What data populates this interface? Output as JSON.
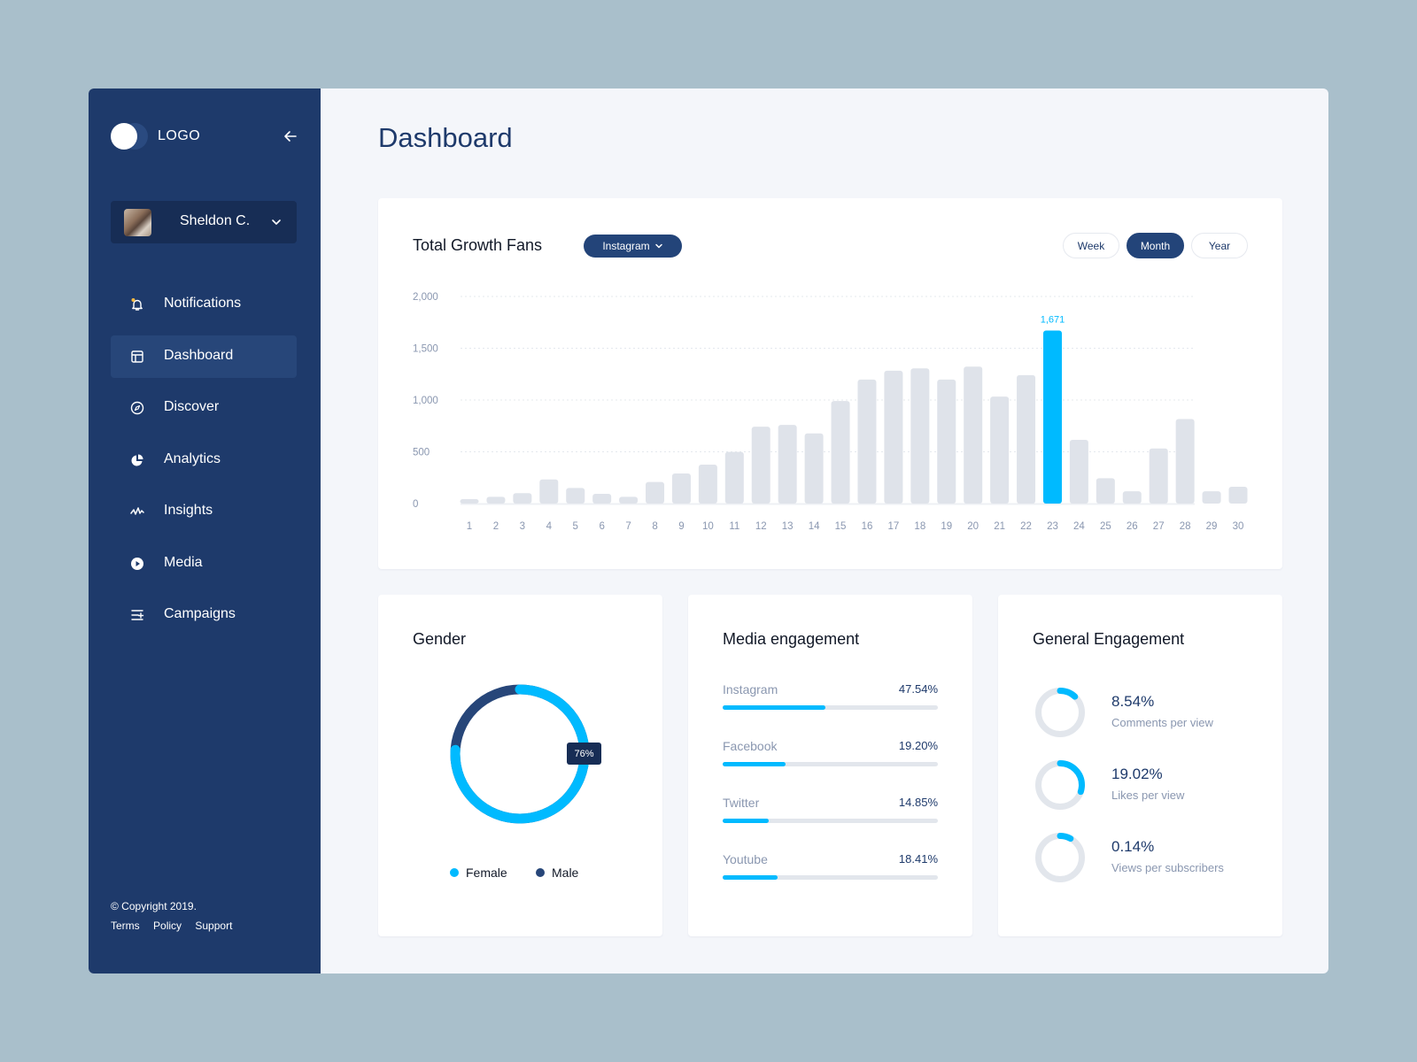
{
  "colors": {
    "accent": "#00BAFF",
    "primary": "#1E3A6B",
    "bar_default": "#DFE3EA",
    "track": "#E2E6EC",
    "male": "#274679"
  },
  "sidebar": {
    "logo_text": "LOGO",
    "collapse_icon": "arrow-left-icon",
    "user": {
      "name": "Sheldon C.",
      "chevron": "chevron-down-icon"
    },
    "items": [
      {
        "label": "Notifications",
        "icon": "bell-icon",
        "active": false
      },
      {
        "label": "Dashboard",
        "icon": "layout-icon",
        "active": true
      },
      {
        "label": "Discover",
        "icon": "compass-icon",
        "active": false
      },
      {
        "label": "Analytics",
        "icon": "pie-chart-icon",
        "active": false
      },
      {
        "label": "Insights",
        "icon": "activity-icon",
        "active": false
      },
      {
        "label": "Media",
        "icon": "play-icon",
        "active": false
      },
      {
        "label": "Campaigns",
        "icon": "list-plus-icon",
        "active": false
      }
    ],
    "footer": {
      "copyright": "© Copyright 2019.",
      "links": [
        "Terms",
        "Policy",
        "Support"
      ]
    }
  },
  "main": {
    "title": "Dashboard",
    "growth": {
      "title": "Total Growth Fans",
      "platform": "Instagram",
      "ranges": [
        {
          "label": "Week",
          "active": false
        },
        {
          "label": "Month",
          "active": true
        },
        {
          "label": "Year",
          "active": false
        }
      ]
    },
    "gender": {
      "title": "Gender",
      "tooltip": "76%",
      "female_share": 0.76,
      "legend": [
        {
          "label": "Female",
          "color": "#00BAFF"
        },
        {
          "label": "Male",
          "color": "#274679"
        }
      ]
    },
    "media_engagement": {
      "title": "Media engagement",
      "rows": [
        {
          "label": "Instagram",
          "value": "47.54%",
          "fraction": 0.4754
        },
        {
          "label": "Facebook",
          "value": "19.20%",
          "fraction": 0.292
        },
        {
          "label": "Twitter",
          "value": "14.85%",
          "fraction": 0.215
        },
        {
          "label": "Youtube",
          "value": "18.41%",
          "fraction": 0.255
        }
      ]
    },
    "general_engagement": {
      "title": "General Engagement",
      "rows": [
        {
          "value": "8.54%",
          "label": "Comments per view",
          "fraction": 0.12
        },
        {
          "value": "19.02%",
          "label": "Likes per view",
          "fraction": 0.3
        },
        {
          "value": "0.14%",
          "label": "Views per subscribers",
          "fraction": 0.08
        }
      ]
    }
  },
  "chart_data": {
    "type": "bar",
    "title": "Total Growth Fans",
    "xlabel": "",
    "ylabel": "",
    "ylim": [
      0,
      2000
    ],
    "yticks": [
      0,
      500,
      1000,
      1500,
      2000
    ],
    "ytick_labels": [
      "0",
      "500",
      "1,000",
      "1,500",
      "2,000"
    ],
    "grid": true,
    "categories": [
      "1",
      "2",
      "3",
      "4",
      "5",
      "6",
      "7",
      "8",
      "9",
      "10",
      "11",
      "12",
      "13",
      "14",
      "15",
      "16",
      "17",
      "18",
      "19",
      "20",
      "21",
      "22",
      "23",
      "24",
      "25",
      "26",
      "27",
      "28",
      "29",
      "30"
    ],
    "values": [
      43,
      65,
      100,
      233,
      151,
      94,
      65,
      208,
      291,
      376,
      499,
      743,
      760,
      677,
      990,
      1198,
      1283,
      1306,
      1198,
      1323,
      1033,
      1240,
      1671,
      615,
      245,
      119,
      532,
      816,
      119,
      162
    ],
    "highlight_index": 22,
    "highlight_label": "1,671"
  }
}
